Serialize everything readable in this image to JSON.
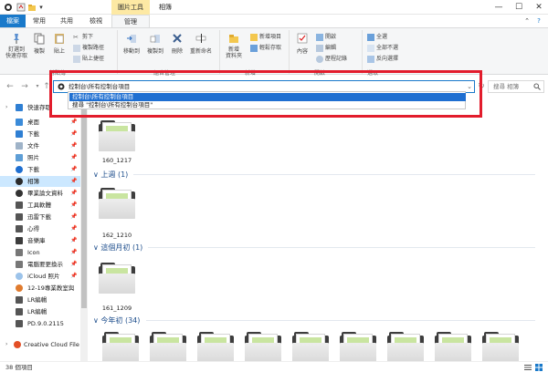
{
  "window": {
    "title": "相簿",
    "context_tab": "圖片工具",
    "minimize": "—",
    "maximize": "☐",
    "close": "✕",
    "help": "?"
  },
  "tabs": {
    "file": "檔案",
    "home": "常用",
    "share": "共用",
    "view": "檢視",
    "manage": "管理"
  },
  "ribbon": {
    "pin": "釘選到\n快速存取",
    "copy": "複製",
    "paste": "貼上",
    "cut": "剪下",
    "copy_path": "複製路徑",
    "paste_shortcut": "貼上捷徑",
    "move_to": "移動到",
    "copy_to": "複製到",
    "delete": "刪除",
    "rename": "重新命名",
    "new_folder": "新增\n資料夾",
    "new_item": "新增項目",
    "easy_access": "輕鬆存取",
    "properties": "內容",
    "open": "開啟",
    "edit": "編輯",
    "history": "歷程記錄",
    "select_all": "全選",
    "select_none": "全部不選",
    "invert": "反向選擇",
    "group_clipboard": "剪貼簿",
    "group_organize": "組合管理",
    "group_new": "新增",
    "group_open": "開啟",
    "group_select": "選取"
  },
  "address": {
    "value": "控制台\\所有控制台項目",
    "search_placeholder": "搜尋 相簿",
    "suggestions": [
      "控制台\\所有控制台項目",
      "搜尋 \"控制台\\所有控制台項目\""
    ]
  },
  "sidebar": {
    "items": [
      {
        "label": "快速存取",
        "pin": ""
      },
      {
        "label": "桌面",
        "pin": "📌"
      },
      {
        "label": "下載",
        "pin": "📌"
      },
      {
        "label": "文件",
        "pin": "📌"
      },
      {
        "label": "照片",
        "pin": "📌"
      },
      {
        "label": "下載",
        "pin": "📌"
      },
      {
        "label": "相簿",
        "pin": "📌"
      },
      {
        "label": "畢業論文資料",
        "pin": "📌"
      },
      {
        "label": "工具軟體",
        "pin": "📌"
      },
      {
        "label": "迅雷下載",
        "pin": "📌"
      },
      {
        "label": "心得",
        "pin": "📌"
      },
      {
        "label": "音樂庫",
        "pin": "📌"
      },
      {
        "label": "Icon",
        "pin": "📌"
      },
      {
        "label": "電腦要更換示",
        "pin": "📌"
      },
      {
        "label": "iCloud 照片",
        "pin": "📌"
      },
      {
        "label": "12-19專業教室與",
        "pin": ""
      },
      {
        "label": "LR編輯",
        "pin": ""
      },
      {
        "label": "LR編輯",
        "pin": ""
      },
      {
        "label": "PD.9.0.2115",
        "pin": ""
      },
      {
        "label": "Creative Cloud File",
        "pin": ""
      }
    ]
  },
  "groups": [
    {
      "header": "",
      "folders": [
        "160_1217"
      ]
    },
    {
      "header": "上週 (1)",
      "folders": [
        "162_1210"
      ]
    },
    {
      "header": "這個月初 (1)",
      "folders": [
        "161_1209"
      ]
    },
    {
      "header": "今年初 (34)",
      "folders": [
        "",
        "",
        "",
        "",
        "",
        "",
        "",
        "",
        "",
        ""
      ]
    }
  ],
  "status": {
    "count": "38 個項目"
  },
  "colors": {
    "accent": "#1979ca",
    "highlight": "#e21c2c",
    "selection": "#1f6fd1",
    "group_header": "#1e4e8c",
    "context_tab": "#fde9a4"
  }
}
